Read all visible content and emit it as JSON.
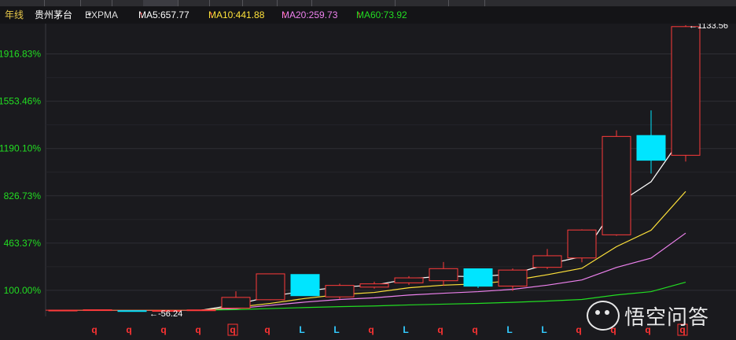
{
  "header": {
    "period": "年线",
    "stock_name": "贵州茅台",
    "indicator": "EXPMA",
    "ma": [
      {
        "label": "MA5:657.77",
        "color": "#ffffff"
      },
      {
        "label": "MA10:441.88",
        "color": "#ffe23a"
      },
      {
        "label": "MA20:259.73",
        "color": "#ee82ee"
      },
      {
        "label": "MA60:73.92",
        "color": "#22dd22"
      }
    ],
    "up_arrow": "↑"
  },
  "chart_data": {
    "type": "candlestick",
    "y_axis_labels": [
      "1916.83%",
      "1553.46%",
      "1190.10%",
      "826.73%",
      "463.37%",
      "100.00%"
    ],
    "y_axis_values": [
      1916.83,
      1553.46,
      1190.1,
      826.73,
      463.37,
      100.0
    ],
    "ylim": [
      -100,
      2150
    ],
    "candles": [
      {
        "open": -52,
        "high": -52,
        "low": -52,
        "close": -52,
        "color": "red"
      },
      {
        "open": -50,
        "high": -48,
        "low": -53,
        "close": -49,
        "color": "red"
      },
      {
        "open": -56,
        "high": -54,
        "low": -58,
        "close": -56,
        "color": "cyan"
      },
      {
        "open": -56,
        "high": -54,
        "low": -58,
        "close": -55,
        "color": "red"
      },
      {
        "open": -52,
        "high": -48,
        "low": -55,
        "close": -50,
        "color": "red"
      },
      {
        "open": -36,
        "high": 93,
        "low": -39,
        "close": 46,
        "color": "red"
      },
      {
        "open": 28,
        "high": 229,
        "low": 24,
        "close": 227,
        "color": "red"
      },
      {
        "open": 222,
        "high": 222,
        "low": 62,
        "close": 59,
        "color": "cyan"
      },
      {
        "open": 50,
        "high": 152,
        "low": 34,
        "close": 138,
        "color": "red"
      },
      {
        "open": 125,
        "high": 167,
        "low": 113,
        "close": 150,
        "color": "red"
      },
      {
        "open": 158,
        "high": 209,
        "low": 142,
        "close": 196,
        "color": "red"
      },
      {
        "open": 174,
        "high": 318,
        "low": 134,
        "close": 267,
        "color": "red"
      },
      {
        "open": 266,
        "high": 266,
        "low": 118,
        "close": 132,
        "color": "cyan"
      },
      {
        "open": 133,
        "high": 268,
        "low": 96,
        "close": 256,
        "color": "red"
      },
      {
        "open": 277,
        "high": 418,
        "low": 264,
        "close": 366,
        "color": "red"
      },
      {
        "open": 349,
        "high": 569,
        "low": 316,
        "close": 564,
        "color": "red"
      },
      {
        "open": 527,
        "high": 1330,
        "low": 519,
        "close": 1283,
        "color": "red"
      },
      {
        "open": 1290,
        "high": 1483,
        "low": 998,
        "close": 1100,
        "color": "cyan"
      },
      {
        "open": 1138,
        "high": 2138,
        "low": 1090,
        "close": 2127,
        "color": "red"
      }
    ],
    "series": [
      {
        "name": "MA5",
        "color": "#ffffff",
        "values": [
          -52,
          -52,
          -53,
          -53,
          -52,
          -10,
          54,
          95,
          125,
          140,
          188,
          210,
          205,
          226,
          300,
          360,
          760,
          935,
          1317
        ]
      },
      {
        "name": "MA10",
        "color": "#ffe23a",
        "values": [
          -52,
          -52,
          -52,
          -52,
          -52,
          -30,
          0,
          38,
          68,
          84,
          120,
          140,
          150,
          176,
          220,
          270,
          436,
          562,
          860
        ]
      },
      {
        "name": "MA20",
        "color": "#ee82ee",
        "values": [
          -52,
          -52,
          -52,
          -52,
          -52,
          -40,
          -15,
          10,
          30,
          43,
          64,
          78,
          90,
          108,
          140,
          180,
          276,
          348,
          540
        ]
      },
      {
        "name": "MA60",
        "color": "#22dd22",
        "values": [
          -52,
          -52,
          -52,
          -52,
          -52,
          -48,
          -40,
          -32,
          -25,
          -20,
          -12,
          -6,
          0,
          8,
          18,
          30,
          65,
          90,
          163
        ]
      }
    ],
    "annotations": {
      "max_label": "1133.56",
      "max_arrow": "←",
      "min_label": "-56.24",
      "min_arrow": "←"
    },
    "x_markers": [
      {
        "text": "",
        "color": "#ff3333",
        "boxed": false
      },
      {
        "text": "",
        "color": "#ff3333",
        "boxed": false
      },
      {
        "text": "q",
        "color": "#ff3333",
        "boxed": false
      },
      {
        "text": "q",
        "color": "#ff3333",
        "boxed": false
      },
      {
        "text": "q",
        "color": "#ff3333",
        "boxed": false
      },
      {
        "text": "q",
        "color": "#ff3333",
        "boxed": false
      },
      {
        "text": "q",
        "color": "#ff3333",
        "boxed": true
      },
      {
        "text": "q",
        "color": "#ff3333",
        "boxed": false
      },
      {
        "text": "L",
        "color": "#33ccff",
        "boxed": false
      },
      {
        "text": "L",
        "color": "#33ccff",
        "boxed": false
      },
      {
        "text": "q",
        "color": "#ff3333",
        "boxed": false
      },
      {
        "text": "L",
        "color": "#33ccff",
        "boxed": false
      },
      {
        "text": "q",
        "color": "#ff3333",
        "boxed": false
      },
      {
        "text": "q",
        "color": "#ff3333",
        "boxed": false
      },
      {
        "text": "L",
        "color": "#33ccff",
        "boxed": false
      },
      {
        "text": "L",
        "color": "#33ccff",
        "boxed": false
      },
      {
        "text": "q",
        "color": "#ff3333",
        "boxed": false
      },
      {
        "text": "q",
        "color": "#ff3333",
        "boxed": false
      },
      {
        "text": "q",
        "color": "#ff3333",
        "boxed": false
      },
      {
        "text": "q",
        "color": "#ff3333",
        "boxed": true
      }
    ],
    "grid": true,
    "colors": {
      "up": "#ff3b3b",
      "down": "#00e5ff",
      "grid": "#2e2e34",
      "axis_text": "#22dd22"
    }
  },
  "watermark": {
    "text": "悟空问答",
    "icon": "wukong-logo-icon"
  }
}
